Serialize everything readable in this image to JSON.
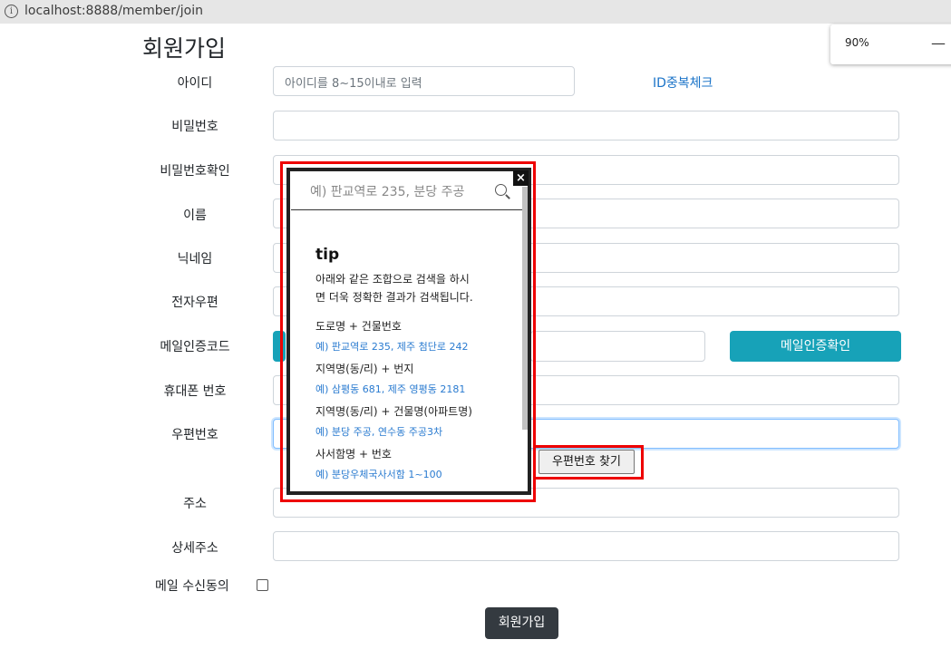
{
  "browser": {
    "url": "localhost:8888/member/join",
    "info_icon": "info-icon",
    "zoom": "90%",
    "zoom_minus": "—"
  },
  "page": {
    "title": "회원가입"
  },
  "form": {
    "id_label": "아이디",
    "id_placeholder": "아이디를  8~15이내로 입력",
    "id_check_link": "ID중복체크",
    "password_label": "비밀번호",
    "password_confirm_label": "비밀번호확인",
    "name_label": "이름",
    "nickname_label": "닉네임",
    "email_label": "전자우편",
    "email_code_label": "메일인증코드",
    "email_confirm_button": "메일인증확인",
    "phone_label": "휴대폰 번호",
    "zipcode_label": "우편번호",
    "zipcode_button": "우편번호 찾기",
    "address_label": "주소",
    "detail_address_label": "상세주소",
    "mail_consent_label": "메일 수신동의",
    "submit_button": "회원가입"
  },
  "popup": {
    "close": "×",
    "search_placeholder": "예) 판교역로 235, 분당 주공",
    "tip_title": "tip",
    "tip_text_1": "아래와 같은 조합으로 검색을 하시",
    "tip_text_2": "면 더욱 정확한 결과가 검색됩니다.",
    "examples": [
      {
        "category": "도로명 + 건물번호",
        "example": "예) 판교역로 235,  제주 첨단로 242"
      },
      {
        "category": "지역명(동/리) + 번지",
        "example": "예) 삼평동 681,  제주 영평동 2181"
      },
      {
        "category": "지역명(동/리) + 건물명(아파트명)",
        "example": "예) 분당 주공,  연수동 주공3차"
      },
      {
        "category": "사서함명 + 번호",
        "example": "예) 분당우체국사서함 1~100"
      }
    ]
  },
  "colors": {
    "accent": "#17a2b8",
    "highlight": "#ee0000",
    "link": "#2a7bd0",
    "dark_button": "#343a40"
  }
}
